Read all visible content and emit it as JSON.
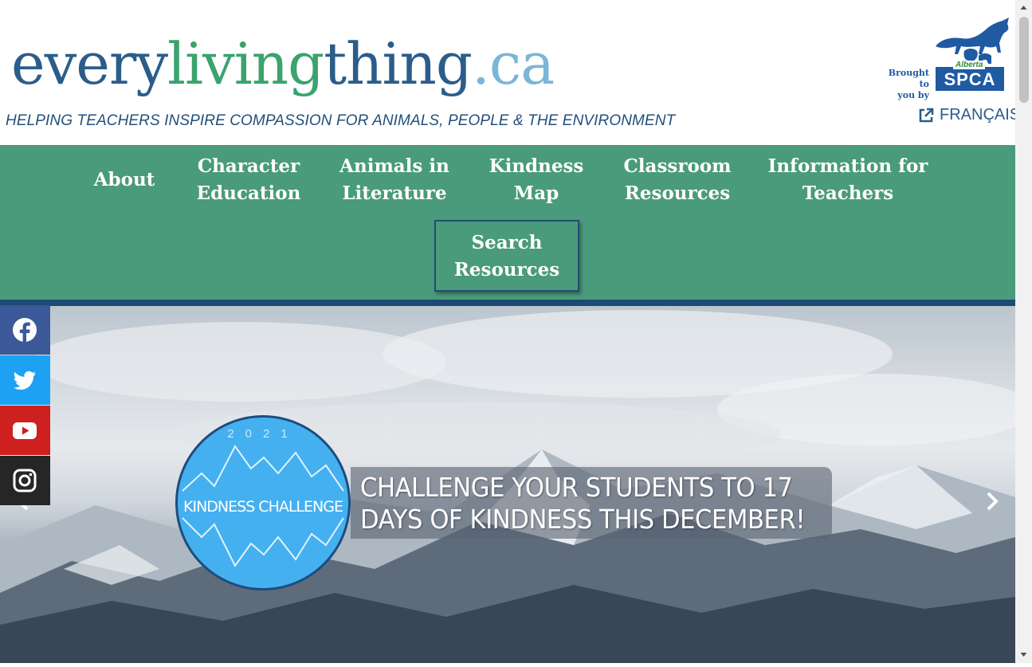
{
  "header": {
    "logo_parts": [
      "every",
      "living",
      "thing",
      ".ca"
    ],
    "tagline": "HELPING TEACHERS INSPIRE COMPASSION FOR ANIMALS, PEOPLE & THE ENVIRONMENT",
    "brought_by_line1": "Brought to",
    "brought_by_line2": "you by",
    "spca_province": "Alberta",
    "spca_label": "SPCA",
    "language_link": "FRANÇAIS",
    "language_icon": "external-link-icon"
  },
  "nav": {
    "items": [
      {
        "line1": "About",
        "line2": ""
      },
      {
        "line1": "Character",
        "line2": "Education"
      },
      {
        "line1": "Animals in",
        "line2": "Literature"
      },
      {
        "line1": "Kindness",
        "line2": "Map"
      },
      {
        "line1": "Classroom",
        "line2": "Resources"
      },
      {
        "line1": "Information for",
        "line2": "Teachers"
      }
    ],
    "search": {
      "line1": "Search",
      "line2": "Resources"
    }
  },
  "hero": {
    "badge_year": "2021",
    "badge_title": "KINDNESS CHALLENGE",
    "headline_line1": "CHALLENGE YOUR STUDENTS TO 17",
    "headline_line2": "DAYS OF KINDNESS THIS DECEMBER!",
    "prev_icon": "chevron-left-icon",
    "next_icon": "chevron-right-icon"
  },
  "social": [
    {
      "name": "facebook",
      "icon": "facebook-icon",
      "color": "#3b5998"
    },
    {
      "name": "twitter",
      "icon": "twitter-icon",
      "color": "#1da1f2"
    },
    {
      "name": "youtube",
      "icon": "youtube-icon",
      "color": "#cd201f"
    },
    {
      "name": "instagram",
      "icon": "instagram-icon",
      "color": "#262626"
    }
  ],
  "colors": {
    "nav_bg": "#4a9a7c",
    "nav_border": "#1d4a73",
    "brand_blue": "#2b5d8a",
    "brand_green": "#3aa36e"
  }
}
